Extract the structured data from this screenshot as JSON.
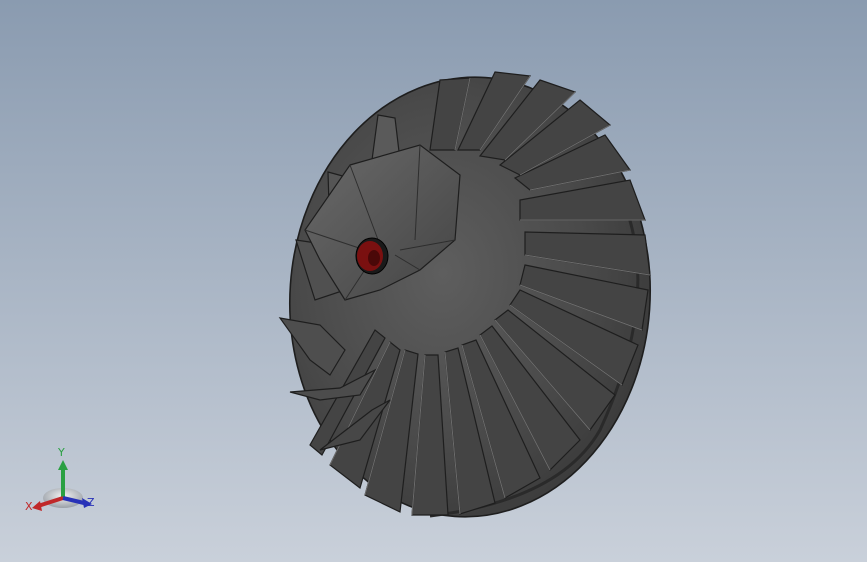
{
  "viewport": {
    "background_top": "#8a9bb0",
    "background_bottom": "#c9d0da"
  },
  "model": {
    "icon": "impeller-model",
    "body_color": "#4a4a4a",
    "edge_color": "#1e1e1e",
    "bore_color": "#7a1010"
  },
  "triad": {
    "x_label": "X",
    "y_label": "Y",
    "z_label": "Z",
    "x_color": "#c0282a",
    "y_color": "#2aa042",
    "z_color": "#2832b8"
  }
}
